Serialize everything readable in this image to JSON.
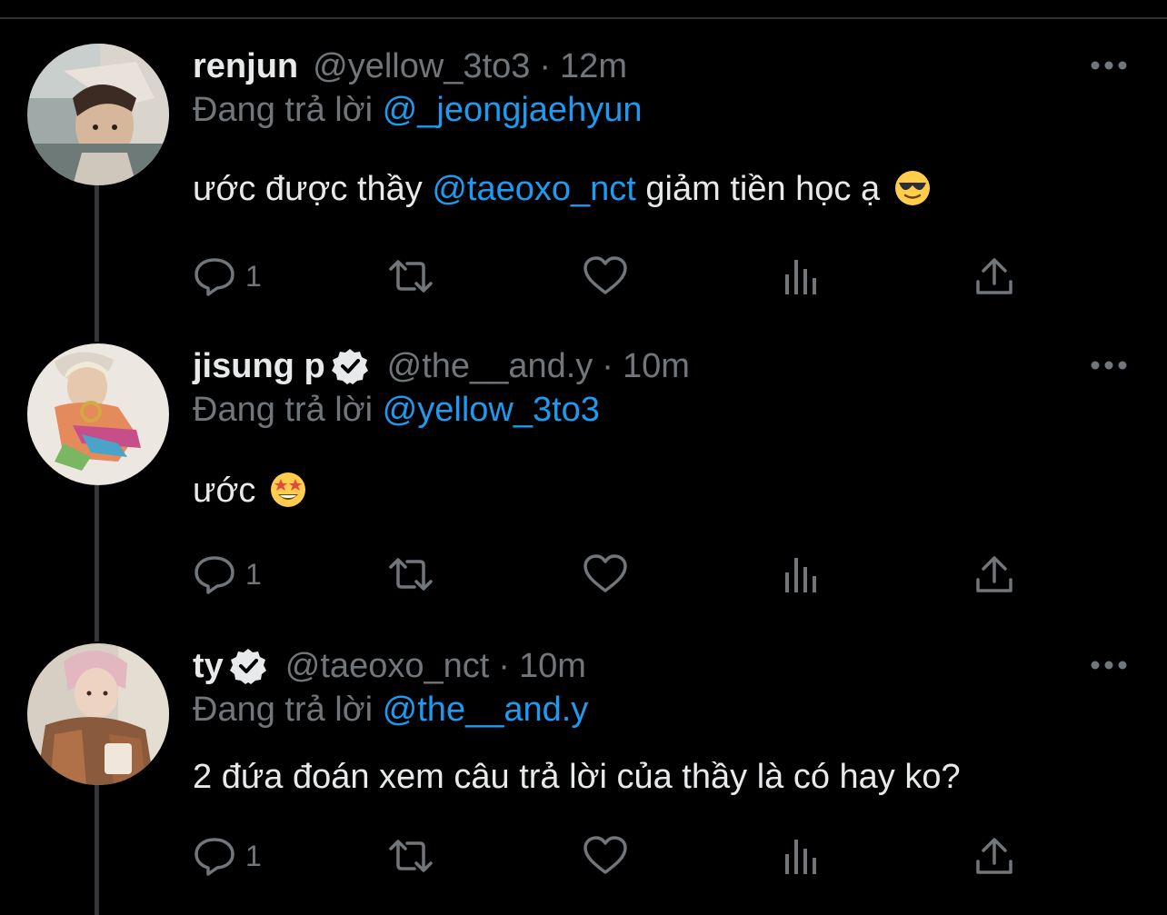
{
  "tweets": [
    {
      "name": "renjun",
      "verified": false,
      "handle": "@yellow_3to3",
      "separator": "·",
      "time": "12m",
      "reply_label": "Đang trả lời",
      "reply_to": "@_jeongjaehyun",
      "text_before": "ước được thầy ",
      "text_mention": "@taeoxo_nct",
      "text_after": " giảm tiền học ạ",
      "emoji": "smiling-face-with-sunglasses",
      "reply_count": "1"
    },
    {
      "name": "jisung p",
      "verified": true,
      "handle": "@the__and.y",
      "separator": "·",
      "time": "10m",
      "reply_label": "Đang trả lời",
      "reply_to": "@yellow_3to3",
      "text_before": "ước",
      "text_mention": "",
      "text_after": "",
      "emoji": "star-struck",
      "reply_count": "1"
    },
    {
      "name": "ty",
      "verified": true,
      "handle": "@taeoxo_nct",
      "separator": "·",
      "time": "10m",
      "reply_label": "Đang trả lời",
      "reply_to": "@the__and.y",
      "text_before": "2 đứa đoán xem câu trả lời của thầy là có hay ko?",
      "text_mention": "",
      "text_after": "",
      "emoji": "",
      "reply_count": "1"
    }
  ],
  "colors": {
    "background": "#000000",
    "text": "#e7e9ea",
    "secondary": "#71767b",
    "link": "#1d9bf0",
    "thread_line": "#333639"
  },
  "icons": [
    "reply-icon",
    "retweet-icon",
    "like-icon",
    "views-icon",
    "share-icon",
    "more-icon",
    "verified-badge-icon"
  ]
}
